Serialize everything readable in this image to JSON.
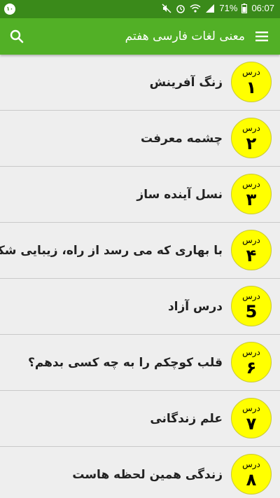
{
  "status_bar": {
    "left_badge": "۱۰",
    "battery": "71%",
    "time": "06:07"
  },
  "app_bar": {
    "title": "معنی لغات فارسی هفتم",
    "menu_icon": "hamburger-menu-icon",
    "search_icon": "search-icon"
  },
  "colors": {
    "status_bar": "#3a8a1a",
    "app_bar": "#52b026",
    "badge": "#ffff00",
    "background": "#eeeeee"
  },
  "lessons": [
    {
      "badge_label": "درس",
      "number": "۱",
      "title": "زنگ آفرینش"
    },
    {
      "badge_label": "درس",
      "number": "۲",
      "title": "چشمه معرفت"
    },
    {
      "badge_label": "درس",
      "number": "۳",
      "title": "نسل آینده ساز"
    },
    {
      "badge_label": "درس",
      "number": "۴",
      "title": "با بهاری که می رسد از راه، زیبایی شکفتن"
    },
    {
      "badge_label": "درس",
      "number": "5",
      "title": "درس آزاد"
    },
    {
      "badge_label": "درس",
      "number": "۶",
      "title": "قلب کوچکم را به چه کسی بدهم؟"
    },
    {
      "badge_label": "درس",
      "number": "۷",
      "title": "علم زندگانی"
    },
    {
      "badge_label": "درس",
      "number": "۸",
      "title": "زندگی همین لحظه هاست"
    }
  ]
}
